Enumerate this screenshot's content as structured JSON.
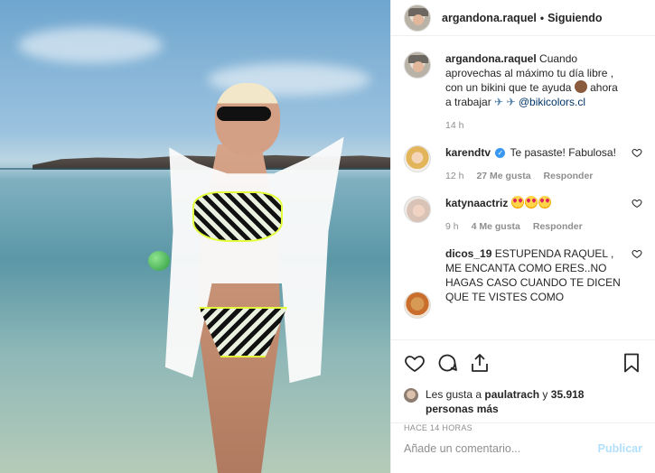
{
  "header": {
    "username": "argandona.raquel",
    "separator": "•",
    "follow_status": "Siguiendo"
  },
  "caption": {
    "username": "argandona.raquel",
    "text_1": "Cuando aprovechas al máximo tu día libre , con un bikini que te ayuda",
    "text_2": "ahora a trabajar",
    "mention": "@bikicolors.cl",
    "time": "14 h"
  },
  "comments": [
    {
      "username": "karendtv",
      "verified": true,
      "text": "Te pasaste! Fabulosa!",
      "time": "12 h",
      "likes": "27 Me gusta",
      "reply": "Responder"
    },
    {
      "username": "katynaactriz",
      "text": "",
      "emoji_count": 3,
      "time": "9 h",
      "likes": "4 Me gusta",
      "reply": "Responder"
    },
    {
      "username": "dicos_19",
      "text": "ESTUPENDA RAQUEL , ME ENCANTA COMO ERES..NO HAGAS CASO CUANDO TE DICEN QUE TE VISTES COMO"
    }
  ],
  "likes": {
    "prefix": "Les gusta a",
    "user": "paulatrach",
    "connector": "y",
    "others": "35.918 personas más"
  },
  "post_time": "HACE 14 HORAS",
  "comment_box": {
    "placeholder": "Añade un comentario...",
    "post_label": "Publicar"
  },
  "icons": {
    "like": "heart-icon",
    "comment": "comment-icon",
    "share": "share-icon",
    "save": "bookmark-icon"
  }
}
